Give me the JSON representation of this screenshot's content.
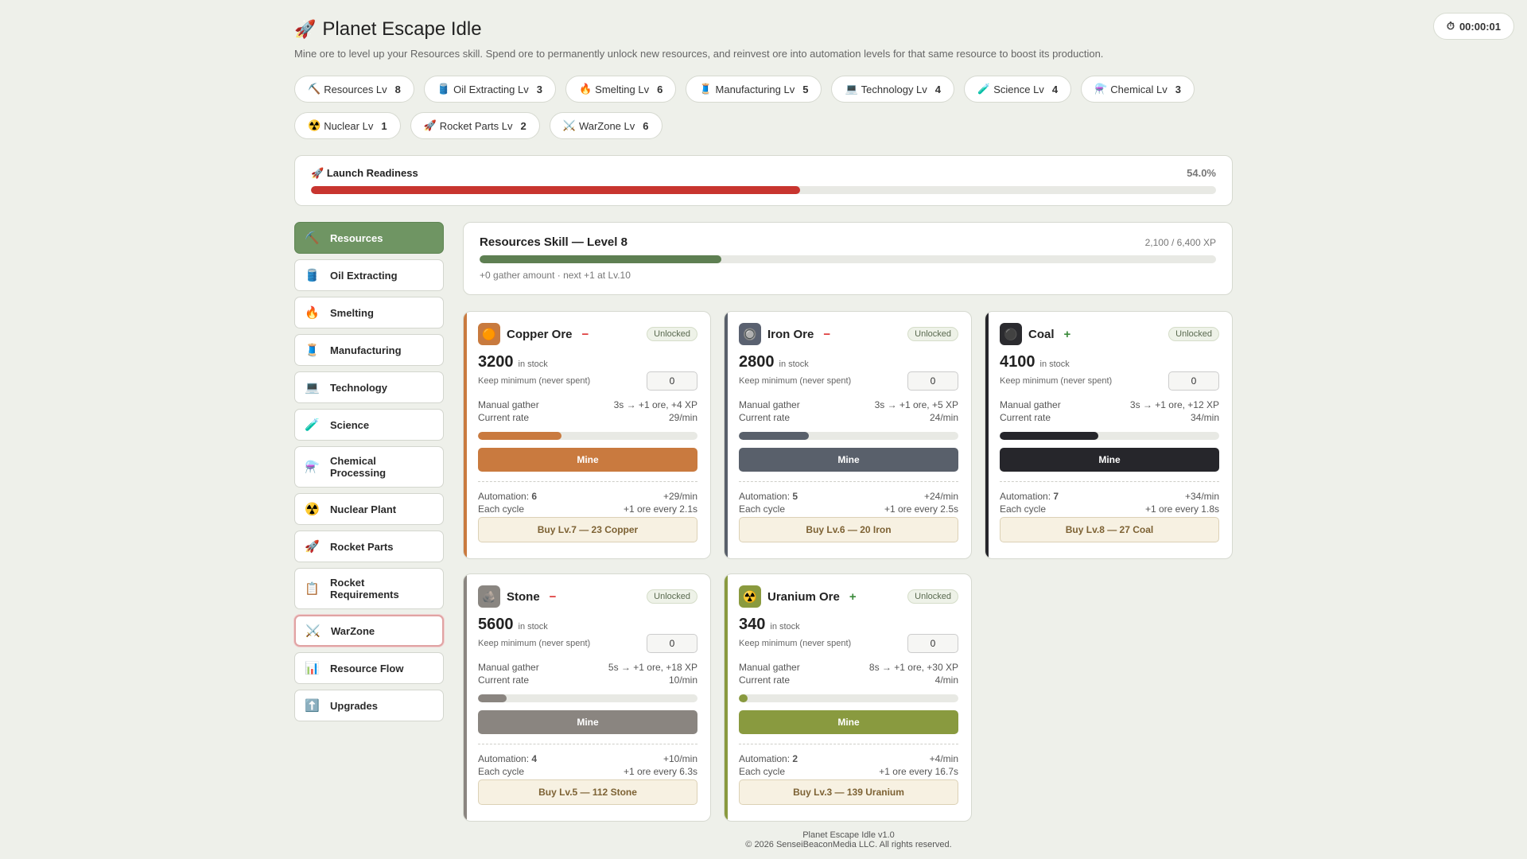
{
  "app": {
    "title_emoji": "🚀",
    "title": "Planet Escape Idle",
    "subtitle": "Mine ore to level up your Resources skill. Spend ore to permanently unlock new resources, and reinvest ore into automation levels for that same resource to boost its production.",
    "timer_icon": "⏱",
    "timer": "00:00:01"
  },
  "chips": [
    {
      "icon": "⛏️",
      "label": "Resources Lv",
      "level": "8"
    },
    {
      "icon": "🛢️",
      "label": "Oil Extracting Lv",
      "level": "3"
    },
    {
      "icon": "🔥",
      "label": "Smelting Lv",
      "level": "6"
    },
    {
      "icon": "🧵",
      "label": "Manufacturing Lv",
      "level": "5"
    },
    {
      "icon": "💻",
      "label": "Technology Lv",
      "level": "4"
    },
    {
      "icon": "🧪",
      "label": "Science Lv",
      "level": "4"
    },
    {
      "icon": "⚗️",
      "label": "Chemical Lv",
      "level": "3"
    },
    {
      "icon": "☢️",
      "label": "Nuclear Lv",
      "level": "1"
    },
    {
      "icon": "🚀",
      "label": "Rocket Parts Lv",
      "level": "2"
    },
    {
      "icon": "⚔️",
      "label": "WarZone Lv",
      "level": "6"
    }
  ],
  "launch": {
    "icon": "🚀",
    "title": "Launch Readiness",
    "percent_text": "54.0%",
    "progress": 0.54,
    "color": "#c8352f"
  },
  "nav": [
    {
      "icon": "⛏️",
      "label": "Resources",
      "active": true
    },
    {
      "icon": "🛢️",
      "label": "Oil Extracting"
    },
    {
      "icon": "🔥",
      "label": "Smelting"
    },
    {
      "icon": "🧵",
      "label": "Manufacturing"
    },
    {
      "icon": "💻",
      "label": "Technology"
    },
    {
      "icon": "🧪",
      "label": "Science"
    },
    {
      "icon": "⚗️",
      "label": "Chemical Processing"
    },
    {
      "icon": "☢️",
      "label": "Nuclear Plant"
    },
    {
      "icon": "🚀",
      "label": "Rocket Parts"
    },
    {
      "icon": "📋",
      "label": "Rocket Requirements"
    },
    {
      "icon": "⚔️",
      "label": "WarZone",
      "warn": true
    },
    {
      "icon": "📊",
      "label": "Resource Flow"
    },
    {
      "icon": "⬆️",
      "label": "Upgrades"
    }
  ],
  "skill": {
    "title": "Resources Skill — Level 8",
    "xp_text": "2,100 / 6,400 XP",
    "progress": 0.328,
    "color": "#5e7f52",
    "note": "+0 gather amount · next +1 at Lv.10"
  },
  "labels": {
    "unlocked": "Unlocked",
    "in_stock": "in stock",
    "keep_min": "Keep minimum (never spent)",
    "manual_gather": "Manual gather",
    "current_rate": "Current rate",
    "mine": "Mine",
    "automation": "Automation:",
    "each_cycle": "Each cycle"
  },
  "resources": [
    {
      "name": "Copper Ore",
      "sign": "−",
      "sign_type": "minus",
      "icon": "🟠",
      "icon_bg": "#c87a3e",
      "stock": "3200",
      "keep": "0",
      "gather": "3s → +1 ore, +4 XP",
      "rate": "29/min",
      "progress": 0.38,
      "color": "#c97a3f",
      "automation": "6",
      "auto_rate": "+29/min",
      "cycle": "+1 ore every 2.1s",
      "buy": "Buy Lv.7 — 23 Copper"
    },
    {
      "name": "Iron Ore",
      "sign": "−",
      "sign_type": "minus",
      "icon": "🔘",
      "icon_bg": "#5a6170",
      "stock": "2800",
      "keep": "0",
      "gather": "3s → +1 ore, +5 XP",
      "rate": "24/min",
      "progress": 0.32,
      "color": "#59606b",
      "automation": "5",
      "auto_rate": "+24/min",
      "cycle": "+1 ore every 2.5s",
      "buy": "Buy Lv.6 — 20 Iron"
    },
    {
      "name": "Coal",
      "sign": "+",
      "sign_type": "plus",
      "icon": "⚫",
      "icon_bg": "#2b2b2f",
      "stock": "4100",
      "keep": "0",
      "gather": "3s → +1 ore, +12 XP",
      "rate": "34/min",
      "progress": 0.45,
      "color": "#26262b",
      "automation": "7",
      "auto_rate": "+34/min",
      "cycle": "+1 ore every 1.8s",
      "buy": "Buy Lv.8 — 27 Coal"
    },
    {
      "name": "Stone",
      "sign": "−",
      "sign_type": "minus",
      "icon": "🪨",
      "icon_bg": "#8a8681",
      "stock": "5600",
      "keep": "0",
      "gather": "5s → +1 ore, +18 XP",
      "rate": "10/min",
      "progress": 0.13,
      "color": "#8a8580",
      "automation": "4",
      "auto_rate": "+10/min",
      "cycle": "+1 ore every 6.3s",
      "buy": "Buy Lv.5 — 112 Stone"
    },
    {
      "name": "Uranium Ore",
      "sign": "+",
      "sign_type": "plus",
      "icon": "☢️",
      "icon_bg": "#8a9a3e",
      "stock": "340",
      "keep": "0",
      "gather": "8s → +1 ore, +30 XP",
      "rate": "4/min",
      "progress": 0.04,
      "color": "#899a3f",
      "automation": "2",
      "auto_rate": "+4/min",
      "cycle": "+1 ore every 16.7s",
      "buy": "Buy Lv.3 — 139 Uranium"
    }
  ],
  "footer": {
    "line1": "Planet Escape Idle v1.0",
    "line2": "© 2026 SenseiBeaconMedia LLC. All rights reserved."
  }
}
